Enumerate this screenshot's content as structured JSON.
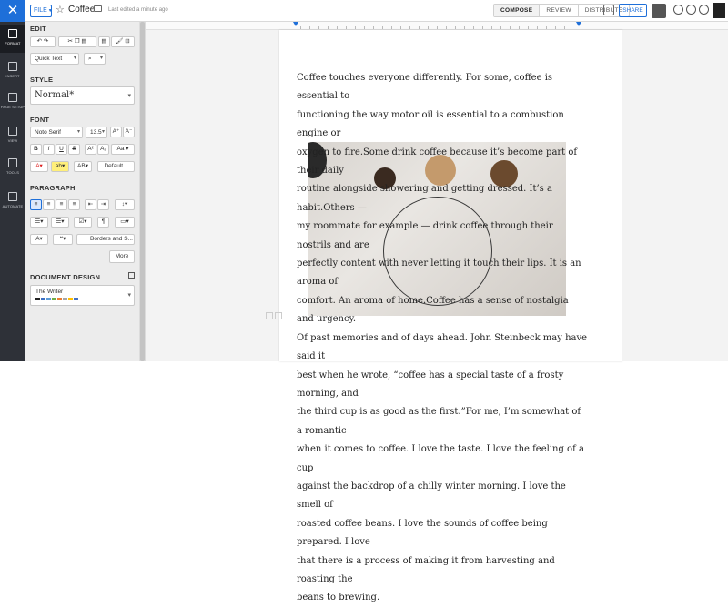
{
  "topbar": {
    "logo": "✕",
    "file_label": "FILE",
    "doc_title": "Coffee",
    "last_edited": "Last edited a minute ago",
    "modes": [
      "COMPOSE",
      "REVIEW",
      "DISTRIBUTE"
    ],
    "active_mode": "COMPOSE",
    "share_label": "SHARE"
  },
  "leftnav": {
    "items": [
      {
        "label": "FORMAT",
        "active": true
      },
      {
        "label": "INSERT",
        "active": false
      },
      {
        "label": "PAGE SETUP",
        "active": false
      },
      {
        "label": "VIEW",
        "active": false
      },
      {
        "label": "TOOLS",
        "active": false
      },
      {
        "label": "AUTOMATE",
        "active": false
      }
    ]
  },
  "panel": {
    "edit_title": "EDIT",
    "quick_text": "Quick Text",
    "style_title": "STYLE",
    "style_value": "Normal*",
    "font_title": "FONT",
    "font_name": "Noto Serif",
    "font_size": "13.5",
    "default_label": "Default...",
    "paragraph_title": "PARAGRAPH",
    "borders_label": "Borders and S...",
    "more_label": "More",
    "design_title": "DOCUMENT DESIGN",
    "design_name": "The Writer",
    "design_colors": [
      "#222222",
      "#3a6fc4",
      "#5b9bd5",
      "#70ad47",
      "#ed7d31",
      "#a5a5a5",
      "#ffc000",
      "#4472c4"
    ]
  },
  "document": {
    "lines": [
      "Coffee touches everyone differently. For some, coffee is essential to",
      "functioning the way motor oil is essential to a combustion engine or",
      "oxygen to fire.Some drink coffee because it’s become part of their daily",
      "routine alongside showering and getting dressed. It’s a habit.Others —",
      "my roommate for example — drink coffee through their nostrils and are",
      "perfectly content with never letting it touch their lips. It is an aroma of",
      "comfort. An aroma of home.Coffee has a sense of nostalgia and urgency.",
      "Of past memories and of days ahead. John Steinbeck may have said it",
      "best when he wrote, “coffee has a special taste of a frosty morning, and",
      "the third cup is as good as the first.”For me, I’m somewhat of a romantic",
      "when it comes to coffee. I love the taste. I love the feeling of a cup",
      "against the backdrop of a chilly winter morning. I love the smell of",
      "roasted coffee beans. I love the sounds of coffee being prepared. I love",
      "that there is a process of making it from harvesting and roasting the",
      "beans to brewing."
    ]
  }
}
